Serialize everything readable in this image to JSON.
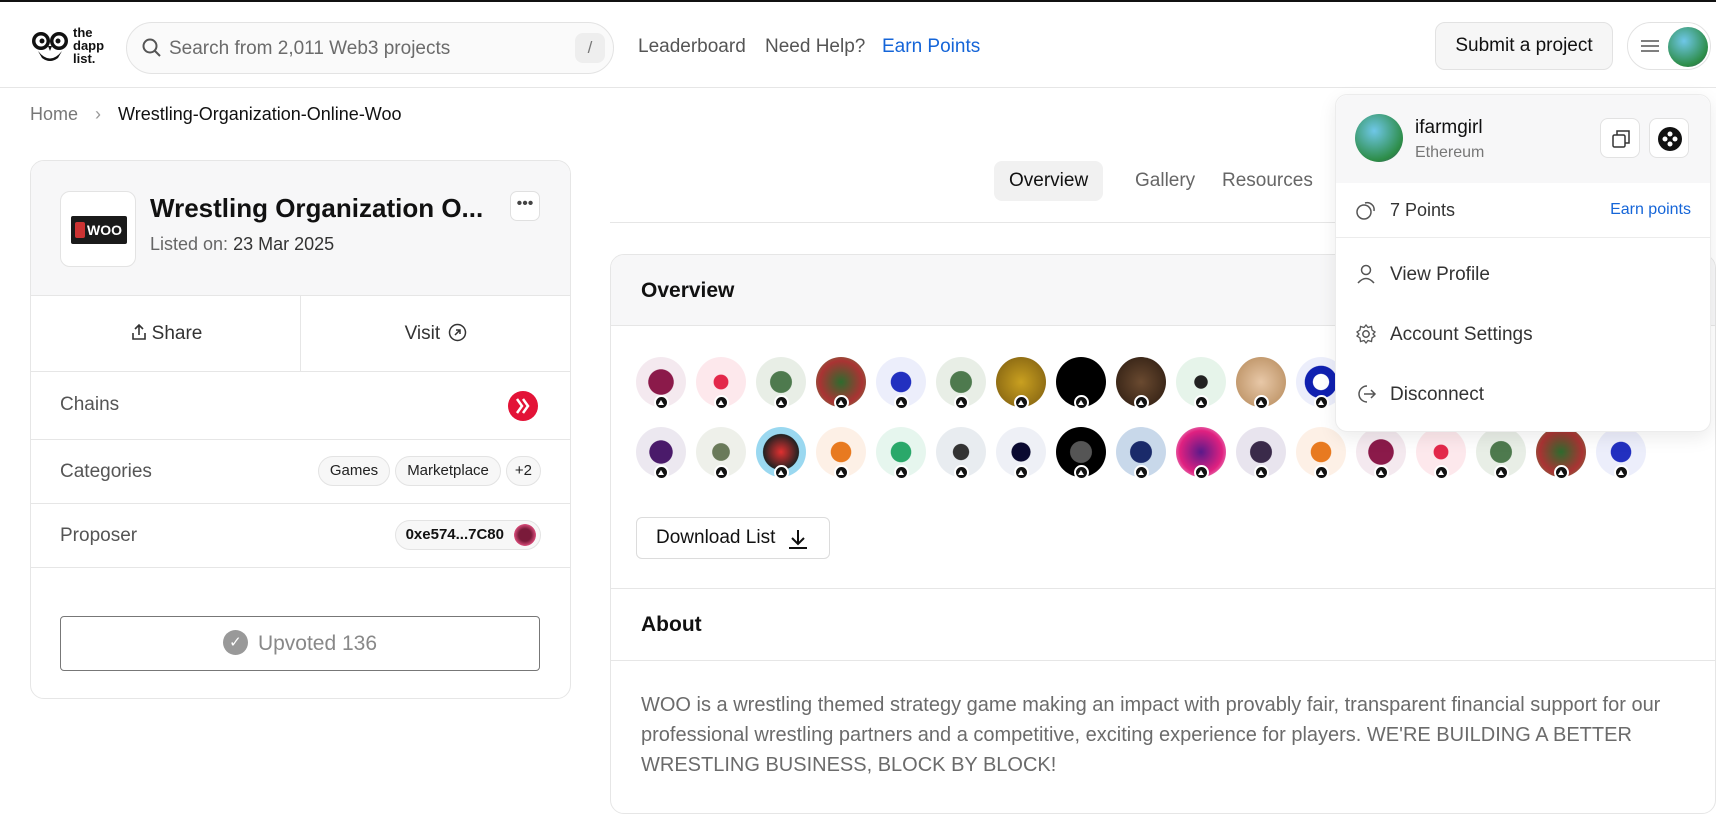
{
  "header": {
    "logo_text": [
      "the",
      "dapp",
      "list."
    ],
    "search_placeholder": "Search from 2,011 Web3 projects",
    "search_shortcut": "/",
    "nav": [
      "Leaderboard",
      "Need Help?",
      "Earn Points"
    ],
    "submit_label": "Submit a project"
  },
  "breadcrumb": {
    "home": "Home",
    "current": "Wrestling-Organization-Online-Woo"
  },
  "project": {
    "logo_text": "WOO",
    "title": "Wrestling Organization O...",
    "listed_label": "Listed on:",
    "listed_date": "23 Mar 2025",
    "share_label": "Share",
    "visit_label": "Visit",
    "chains_label": "Chains",
    "chain_colors": {
      "chain": "#e31337"
    },
    "categories_label": "Categories",
    "categories": [
      "Games",
      "Marketplace",
      "+2"
    ],
    "proposer_label": "Proposer",
    "proposer_address": "0xe574...7C80",
    "upvote_label": "Upvoted 136"
  },
  "tabs": [
    "Overview",
    "Gallery",
    "Resources"
  ],
  "overview": {
    "title": "Overview",
    "upvoter_avatar_count": 34,
    "download_label": "Download List",
    "about_title": "About",
    "about_text": "WOO is a wrestling themed strategy game making an impact with provably fair, transparent financial support for our professional wrestling partners and a competitive, exciting experience for players. WE'RE BUILDING A BETTER WRESTLING BUSINESS, BLOCK BY BLOCK!"
  },
  "account_menu": {
    "username": "ifarmgirl",
    "chain": "Ethereum",
    "points": "7 Points",
    "earn_label": "Earn points",
    "items": [
      "View Profile",
      "Account Settings",
      "Disconnect"
    ]
  },
  "colors": {
    "accent": "#1565d8",
    "text": "#111111",
    "muted": "#6b6b6b"
  }
}
